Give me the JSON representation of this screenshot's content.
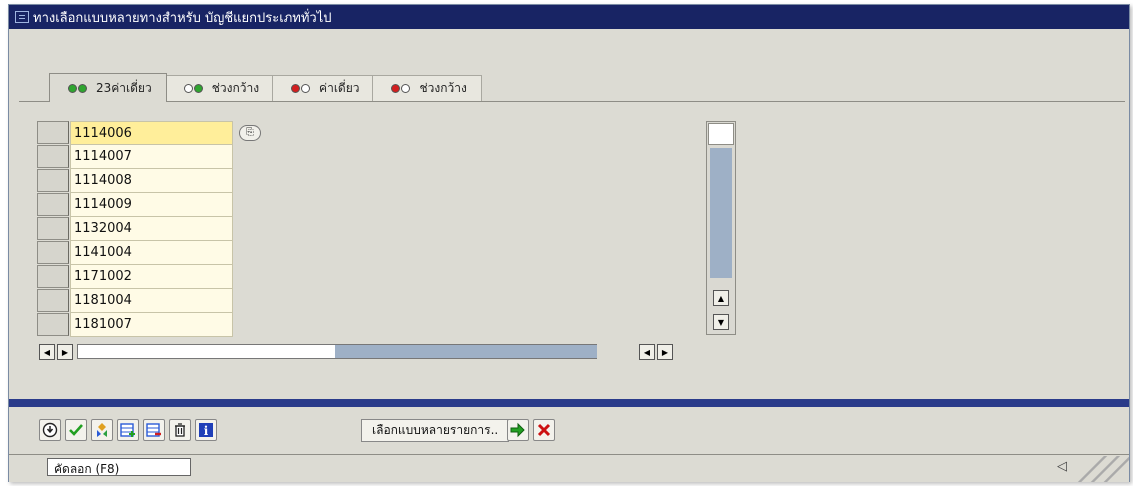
{
  "window": {
    "title": "ทางเลือกแบบหลายทางสำหรับ บัญชีแยกประเภททั่วไป"
  },
  "tabs": [
    {
      "label": "23ค่าเดี่ยว",
      "dots": [
        "g",
        "g"
      ],
      "active": true
    },
    {
      "label": "ช่วงกว้าง",
      "dots": [
        "o",
        "g"
      ],
      "active": false
    },
    {
      "label": "ค่าเดี่ยว",
      "dots": [
        "r",
        "o"
      ],
      "active": false
    },
    {
      "label": "ช่วงกว้าง",
      "dots": [
        "r",
        "o"
      ],
      "active": false
    }
  ],
  "values": [
    "1114006",
    "1114007",
    "1114008",
    "1114009",
    "1132004",
    "1141004",
    "1171002",
    "1181004",
    "1181007"
  ],
  "toolbar": {
    "multiple_selection_label": "เลือกแบบหลายรายการ.."
  },
  "status": {
    "text": "คัดลอก  (F8)"
  },
  "icons": {
    "execute": "execute-icon",
    "check": "check-icon",
    "nav": "options-icon",
    "insert_line": "insert-row-icon",
    "delete_line": "delete-row-icon",
    "trash": "trash-icon",
    "info": "info-icon",
    "import": "import-icon",
    "cancel": "cancel-icon"
  },
  "colors": {
    "titlebar": "#182464",
    "cell": "#fffbe6",
    "focus": "#ffee9a",
    "cancel": "#cc1111",
    "ok": "#22a022"
  }
}
